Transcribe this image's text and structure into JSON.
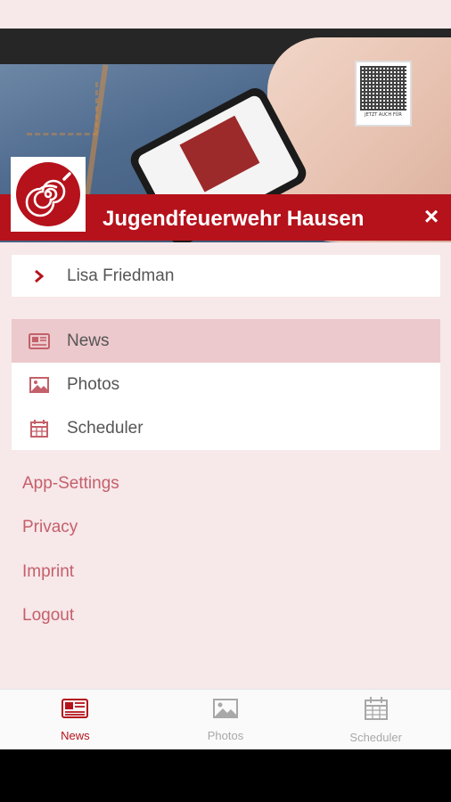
{
  "app": {
    "title": "Jugendfeuerwehr Hausen",
    "close_icon": "close-icon",
    "qr_caption": "JETZT AUCH FÜR"
  },
  "user": {
    "name": "Lisa Friedman",
    "icon": "chevron-right-icon"
  },
  "nav": {
    "items": [
      {
        "label": "News",
        "icon": "newspaper-icon",
        "active": true
      },
      {
        "label": "Photos",
        "icon": "image-icon",
        "active": false
      },
      {
        "label": "Scheduler",
        "icon": "calendar-icon",
        "active": false
      }
    ]
  },
  "links": {
    "items": [
      {
        "label": "App-Settings"
      },
      {
        "label": "Privacy"
      },
      {
        "label": "Imprint"
      },
      {
        "label": "Logout"
      }
    ]
  },
  "tabs": {
    "items": [
      {
        "label": "News",
        "icon": "newspaper-icon",
        "active": true
      },
      {
        "label": "Photos",
        "icon": "image-icon",
        "active": false
      },
      {
        "label": "Scheduler",
        "icon": "calendar-icon",
        "active": false
      }
    ]
  },
  "colors": {
    "accent": "#b5121b",
    "background": "#f7e8ea",
    "active_row": "#ecc9cc",
    "link": "#c4606a",
    "tab_inactive": "#a8a8a8"
  }
}
